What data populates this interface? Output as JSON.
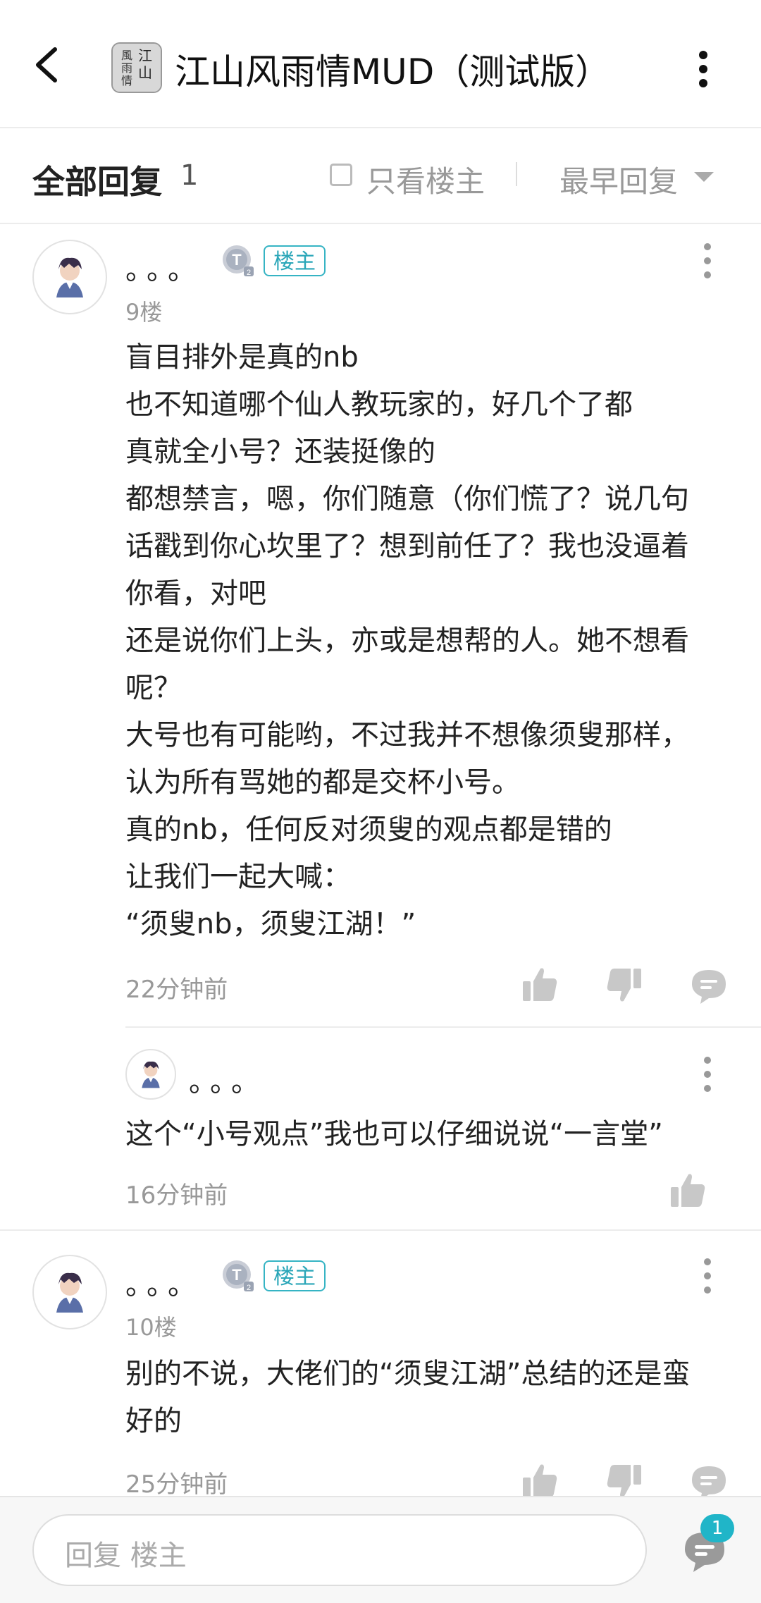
{
  "header": {
    "app_title": "江山风雨情MUD（测试版）",
    "app_icon_text": [
      "江",
      "山",
      "風",
      "雨",
      "情"
    ]
  },
  "filter": {
    "all_replies_label": "全部回复",
    "reply_count": "1",
    "only_op_label": "只看楼主",
    "sort_label": "最早回复"
  },
  "comments": [
    {
      "username": "。。。",
      "op_badge": "楼主",
      "floor": "9楼",
      "lines": [
        "盲目排外是真的nb",
        "也不知道哪个仙人教玩家的，好几个了都",
        "真就全小号？还装挺像的",
        "都想禁言，嗯，你们随意（你们慌了？说几句",
        "话戳到你心坎里了？想到前任了？我也没逼着",
        "你看，对吧",
        "还是说你们上头，亦或是想帮的人。她不想看",
        "呢？",
        "大号也有可能哟，不过我并不想像须叟那样，",
        "认为所有骂她的都是交杯小号。",
        "真的nb，任何反对须叟的观点都是错的",
        "让我们一起大喊：",
        "“须叟nb，须叟江湖！”"
      ],
      "time": "22分钟前",
      "reply": {
        "username": "。。。",
        "text": "这个“小号观点”我也可以仔细说说“一言堂”",
        "time": "16分钟前"
      }
    },
    {
      "username": "。。。",
      "op_badge": "楼主",
      "floor": "10楼",
      "lines": [
        "别的不说，大佬们的“须叟江湖”总结的还是蛮",
        "好的"
      ],
      "time": "25分钟前"
    }
  ],
  "bottom": {
    "reply_placeholder": "回复  楼主",
    "notification_count": "1"
  },
  "colors": {
    "accent": "#2aa6b8",
    "muted_text": "#999999",
    "icon_gray": "#c8c8c8"
  }
}
